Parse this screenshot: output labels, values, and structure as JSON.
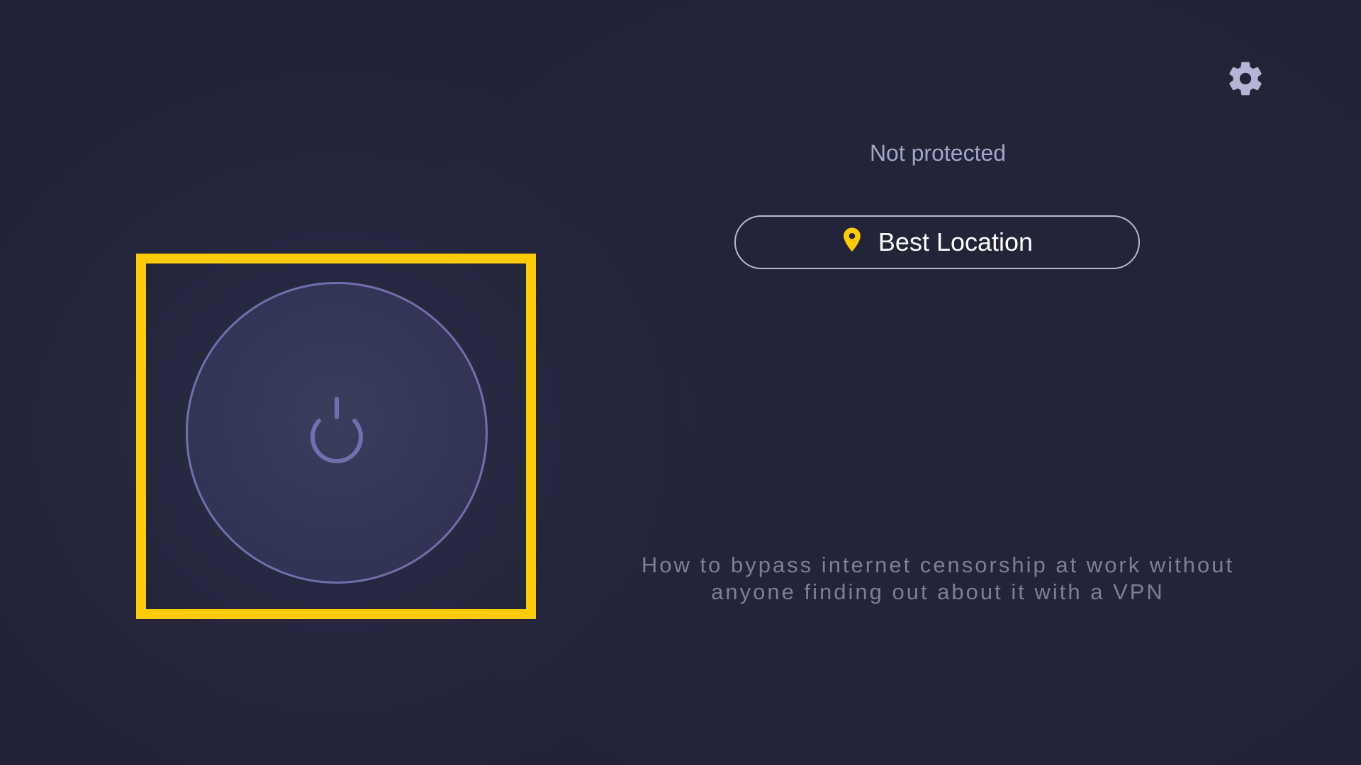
{
  "status": {
    "text": "Not protected"
  },
  "location": {
    "label": "Best Location",
    "icon": "location-pin-icon"
  },
  "settings": {
    "icon": "gear-icon"
  },
  "power": {
    "icon": "power-icon",
    "state": "disconnected"
  },
  "article": {
    "text": "How to bypass internet censorship at work without anyone finding out about it with a VPN"
  },
  "colors": {
    "background": "#222437",
    "accent": "#ffcb05",
    "ring": "#6f70ad",
    "status_text": "#a4a6c6",
    "gear": "#b4b5d7",
    "article_text": "#7d7f99"
  }
}
